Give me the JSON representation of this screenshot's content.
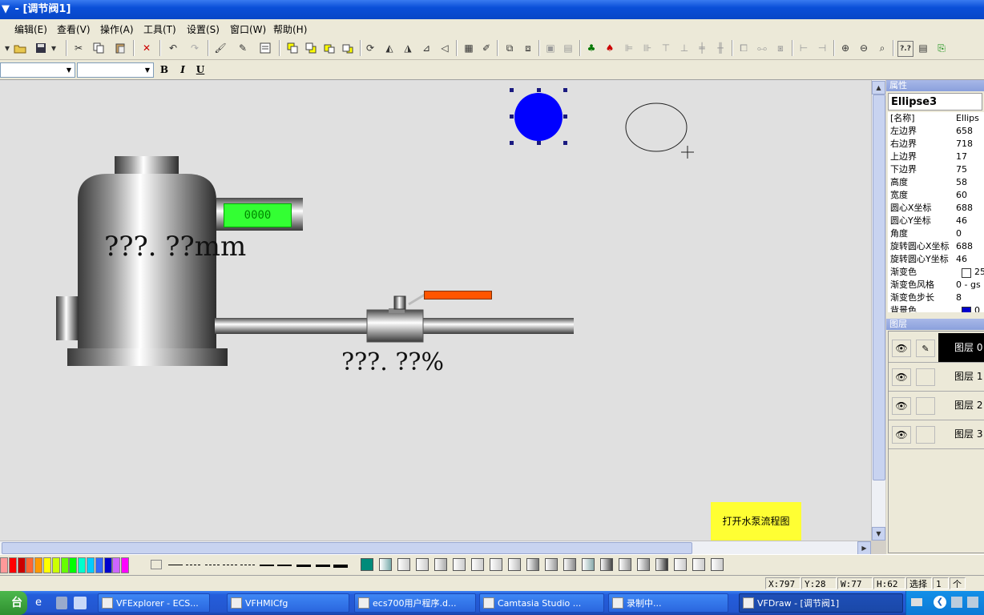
{
  "window": {
    "title_prefix": "▼",
    "title": "- [调节阀1]"
  },
  "menu": [
    "编辑(E)",
    "查看(V)",
    "操作(A)",
    "工具(T)",
    "设置(S)",
    "窗口(W)",
    "帮助(H)"
  ],
  "format_bar": {
    "bold": "B",
    "italic": "I",
    "underline": "U"
  },
  "canvas": {
    "tank_value_text": "???. ??mm",
    "digital_display": "0000",
    "valve_value_text": "???. ??%",
    "open_button_label": "打开水泵流程图",
    "selected_ellipse_color": "#0000ff",
    "display_color": "#33ff33",
    "handle_color": "#ff5500",
    "button_color": "#ffff33"
  },
  "properties": {
    "panel_title": "属性",
    "object_name": "Ellipse3",
    "rows": [
      {
        "k": "[名称]",
        "v": "Ellips"
      },
      {
        "k": "左边界",
        "v": "658"
      },
      {
        "k": "右边界",
        "v": "718"
      },
      {
        "k": "上边界",
        "v": "17"
      },
      {
        "k": "下边界",
        "v": "75"
      },
      {
        "k": "高度",
        "v": "58"
      },
      {
        "k": "宽度",
        "v": "60"
      },
      {
        "k": "圆心X坐标",
        "v": "688"
      },
      {
        "k": "圆心Y坐标",
        "v": "46"
      },
      {
        "k": "角度",
        "v": "0"
      },
      {
        "k": "旋转圆心X坐标",
        "v": "688"
      },
      {
        "k": "旋转圆心Y坐标",
        "v": "46"
      },
      {
        "k": "渐变色",
        "v": "25"
      },
      {
        "k": "渐变色风格",
        "v": "0 - gs"
      },
      {
        "k": "渐变色步长",
        "v": "8"
      },
      {
        "k": "背景色",
        "v": "0"
      }
    ]
  },
  "layers": {
    "panel_title": "图层",
    "items": [
      {
        "name": "图层 0",
        "active": true
      },
      {
        "name": "图层 1",
        "active": false
      },
      {
        "name": "图层 2",
        "active": false
      },
      {
        "name": "图层 3",
        "active": false
      }
    ]
  },
  "palette_colors": [
    "#ff9999",
    "#ff0000",
    "#cc0000",
    "#ff6633",
    "#ff9900",
    "#ffff00",
    "#ccff00",
    "#66ff00",
    "#00ff00",
    "#00ffcc",
    "#00ccff",
    "#3366ff",
    "#0000cc",
    "#cc66ff",
    "#ff00ff"
  ],
  "status": {
    "x": "X:797",
    "y": "Y:28",
    "w": "W:77",
    "h": "H:62",
    "mode": "选择",
    "count": "1",
    "unit": "个"
  },
  "taskbar": {
    "start": "台",
    "tasks": [
      {
        "label": "VFExplorer - ECS...",
        "active": false
      },
      {
        "label": "VFHMICfg",
        "active": false
      },
      {
        "label": "ecs700用户程序.d...",
        "active": false
      },
      {
        "label": "Camtasia Studio ...",
        "active": false
      },
      {
        "label": "录制中...",
        "active": false
      },
      {
        "label": "VFDraw - [调节阀1]",
        "active": true
      }
    ]
  }
}
